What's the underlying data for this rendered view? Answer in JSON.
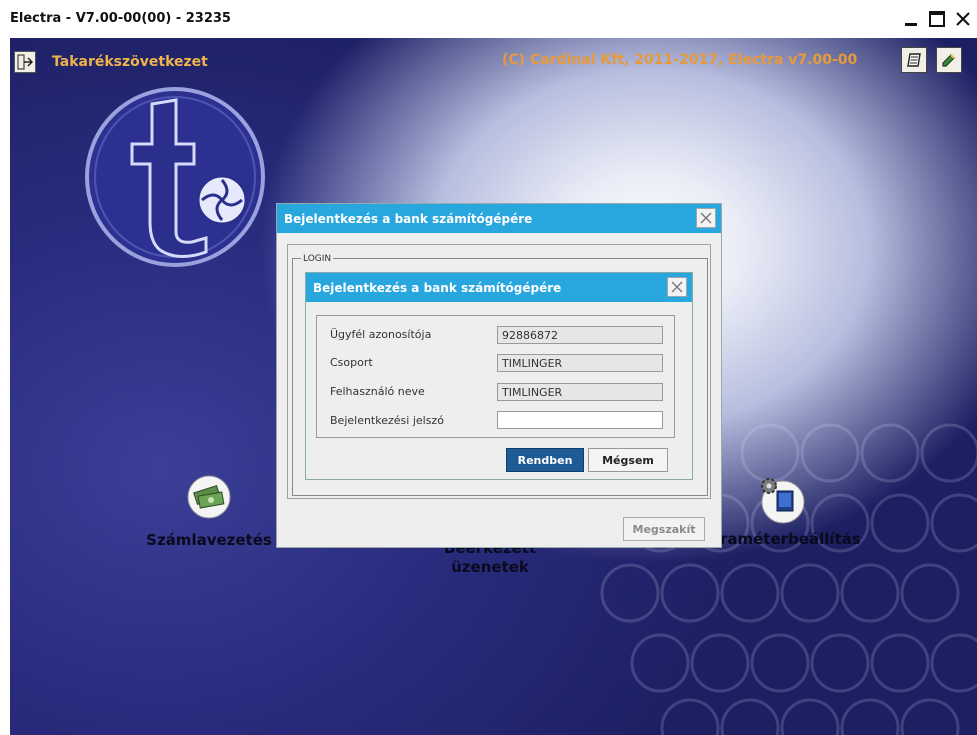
{
  "window": {
    "title": "Electra - V7.00-00(00) - 23235",
    "controls": [
      "minimize-icon",
      "maximize-icon",
      "close-icon"
    ]
  },
  "header": {
    "organization": "Takarékszövetkezet",
    "copyright": "(C) Cardinal Kft, 2011-2017, Electra v7.00-00",
    "exit_icon": "exit-door-icon",
    "tools": [
      "notebook-icon",
      "book-pencil-icon"
    ]
  },
  "tiles": {
    "accounts": {
      "label": "Számlavezetés",
      "icon": "money-icon"
    },
    "messages": {
      "label": "Beérkezett üzenetek"
    },
    "settings": {
      "label": "Paraméterbeállítás",
      "icon": "gear-monitor-icon"
    }
  },
  "outer_dialog": {
    "title": "Bejelentkezés a bank számítógépére",
    "group_label": "LOGIN",
    "abort_label": "Megszakít"
  },
  "login_dialog": {
    "title": "Bejelentkezés a bank számítógépére",
    "fields": [
      {
        "label": "Ügyfél azonosítója",
        "value": "92886872"
      },
      {
        "label": "Csoport",
        "value": "TIMLINGER"
      },
      {
        "label": "Felhasználó neve",
        "value": "TIMLINGER"
      },
      {
        "label": "Bejelentkezési jelszó",
        "value": ""
      }
    ],
    "ok_label": "Rendben",
    "cancel_label": "Mégsem"
  },
  "colors": {
    "dialog_title_bg": "#28a6de",
    "primary_button_bg": "#1f5c96",
    "header_text": "#f0b34a",
    "desktop_bg": "#25297a"
  }
}
